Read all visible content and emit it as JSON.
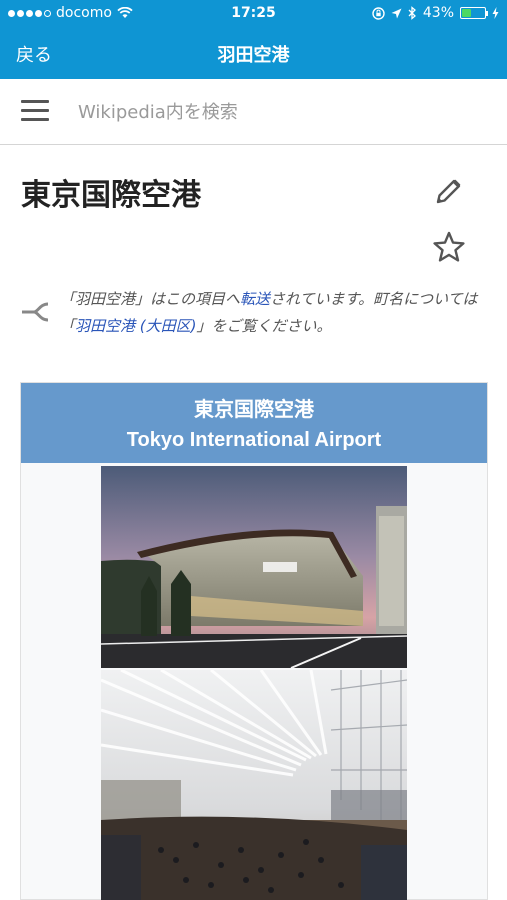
{
  "status_bar": {
    "carrier": "docomo",
    "time": "17:25",
    "battery": "43%",
    "battery_level": 0.43
  },
  "nav": {
    "back_label": "戻る",
    "title": "羽田空港"
  },
  "search": {
    "placeholder": "Wikipedia内を検索"
  },
  "article": {
    "title": "東京国際空港"
  },
  "hatnote": {
    "part1": "「羽田空港」はこの項目へ",
    "link1": "転送",
    "part2": "されています。町名については「",
    "link2": "羽田空港 (大田区)",
    "part3": "」をご覧ください。"
  },
  "infobox": {
    "title_jp": "東京国際空港",
    "title_en": "Tokyo International Airport"
  },
  "colors": {
    "header": "#0f95d3",
    "infobox_header": "#6699cc",
    "link": "#2a55b8"
  }
}
